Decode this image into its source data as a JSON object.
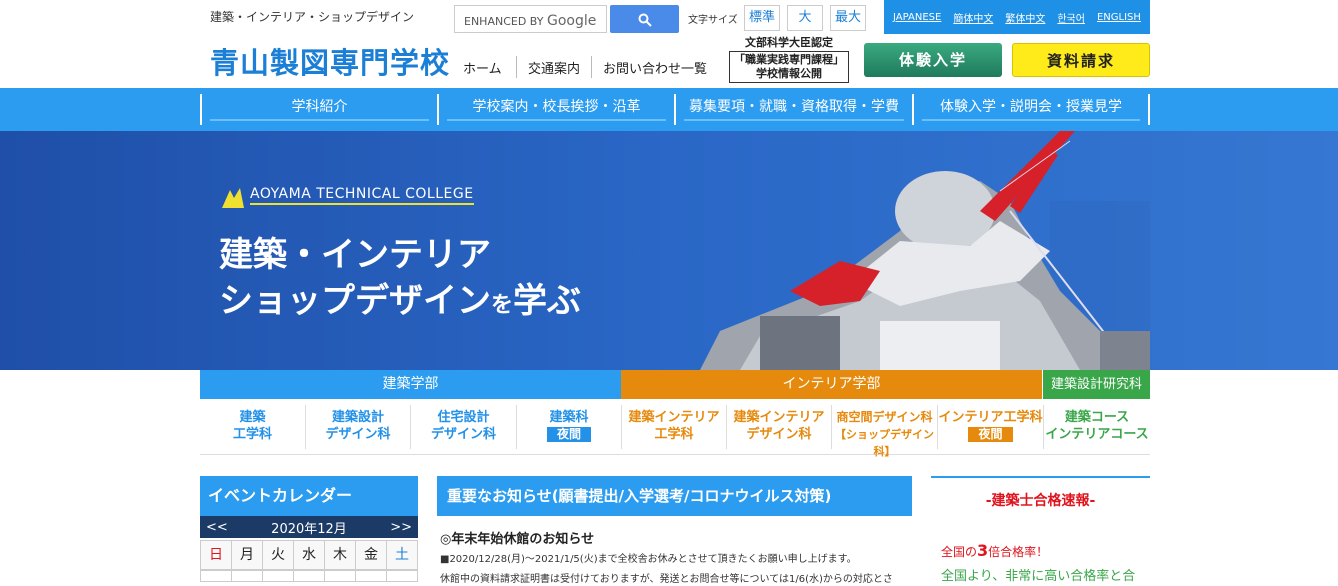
{
  "header": {
    "tagline": "建築・インテリア・ショップデザイン",
    "logo": "青山製図専門学校",
    "search": {
      "enhanced_by": "ENHANCED BY",
      "google": "Google"
    },
    "font_size": {
      "label": "文字サイズ",
      "options": [
        "標準",
        "大",
        "最大"
      ]
    },
    "languages": [
      "JAPANESE",
      "簡体中文",
      "繁体中文",
      "한국어",
      "ENGLISH"
    ],
    "nav": [
      "ホーム",
      "交通案内",
      "お問い合わせ一覧"
    ],
    "mext": {
      "line1": "文部科学大臣認定",
      "line2": "「職業実践専門課程」",
      "line3": "学校情報公開"
    },
    "btn_trial": "体験入学",
    "btn_doc": "資料請求"
  },
  "global_nav": [
    "学科紹介",
    "学校案内・校長挨拶・沿革",
    "募集要項・就職・資格取得・学費",
    "体験入学・説明会・授業見学"
  ],
  "hero": {
    "college_en": "AOYAMA TECHNICAL COLLEGE",
    "line1": "建築・インテリア",
    "line2": "ショップデザイン",
    "line2_suffix_small": "を",
    "line2_suffix": "学ぶ"
  },
  "departments": {
    "groups": [
      "建築学部",
      "インテリア学部",
      "建築設計研究科"
    ],
    "courses": [
      {
        "l1": "建築",
        "l2": "工学科"
      },
      {
        "l1": "建築設計",
        "l2": "デザイン科"
      },
      {
        "l1": "住宅設計",
        "l2": "デザイン科"
      },
      {
        "l1": "建築科",
        "night": "夜間"
      },
      {
        "l1": "建築インテリア",
        "l2": "工学科"
      },
      {
        "l1": "建築インテリア",
        "l2": "デザイン科"
      },
      {
        "l1": "商空間デザイン科",
        "l2": "【ショップデザイン科】"
      },
      {
        "l1": "インテリア工学科",
        "night": "夜間"
      },
      {
        "l1": "建築コース",
        "l2": "インテリアコース"
      }
    ]
  },
  "calendar": {
    "title": "イベントカレンダー",
    "prev": "<<",
    "month": "2020年12月",
    "next": ">>",
    "weekdays": [
      "日",
      "月",
      "火",
      "水",
      "木",
      "金",
      "土"
    ]
  },
  "news": {
    "title": "重要なお知らせ(願書提出/入学選考/コロナウイルス対策)",
    "item_title": "◎年末年始休館のお知らせ",
    "item_p1": "■2020/12/28(月)～2021/1/5(火)まで全校舎お休みとさせて頂きたくお願い申し上げます。",
    "item_p2": "休館中の資料請求証明書は受付けておりますが、発送とお問合せ等については1/6(水)からの対応とさ"
  },
  "pass": {
    "title": "-建築士合格速報-",
    "l1_pre": "全国の",
    "l1_num": "3",
    "l1_post": "倍合格率！",
    "l2": "全国より、非常に高い合格率と合"
  },
  "colors": {
    "primary": "#2b9cf0",
    "orange": "#e68a0e",
    "green": "#3aa64a",
    "red": "#e0141e",
    "yellow": "#ffeb1a"
  }
}
